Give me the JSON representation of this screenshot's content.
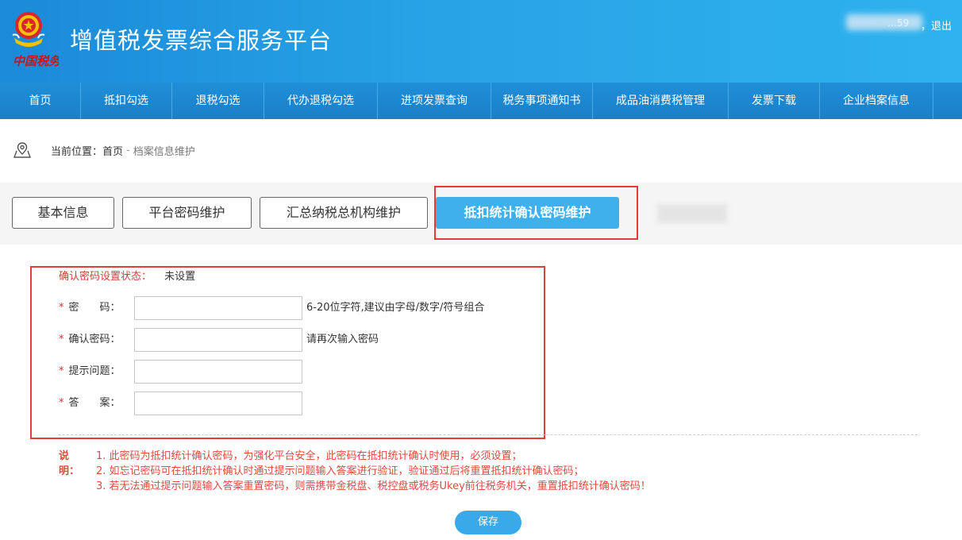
{
  "header": {
    "title": "增值税发票综合服务平台",
    "emblem_text": "中国税务",
    "user_partial": "…59",
    "logout_label": "，退出"
  },
  "nav": {
    "items": [
      {
        "label": "首页"
      },
      {
        "label": "抵扣勾选"
      },
      {
        "label": "退税勾选"
      },
      {
        "label": "代办退税勾选"
      },
      {
        "label": "进项发票查询"
      },
      {
        "label": "税务事项通知书"
      },
      {
        "label": "成品油消费税管理"
      },
      {
        "label": "发票下载"
      },
      {
        "label": "企业档案信息"
      }
    ]
  },
  "breadcrumb": {
    "label": "当前位置：",
    "home": "首页",
    "separator": "-",
    "current": "档案信息维护"
  },
  "tabs": [
    {
      "label": "基本信息"
    },
    {
      "label": "平台密码维护"
    },
    {
      "label": "汇总纳税总机构维护"
    },
    {
      "label": "抵扣统计确认密码维护",
      "active": true
    }
  ],
  "form": {
    "status_label": "确认密码设置状态：",
    "status_value": "未设置",
    "required_mark": "*",
    "password_label": "密　　码：",
    "password_hint": "6-20位字符,建议由字母/数字/符号组合",
    "confirm_label": "确认密码：",
    "confirm_hint": "请再次输入密码",
    "question_label": "提示问题：",
    "answer_label": "答　　案："
  },
  "notes": {
    "title": "说明：",
    "lines": [
      "1. 此密码为抵扣统计确认密码，为强化平台安全，此密码在抵扣统计确认时使用，必须设置；",
      "2. 如忘记密码可在抵扣统计确认时通过提示问题输入答案进行验证，验证通过后将重置抵扣统计确认密码；",
      "3. 若无法通过提示问题输入答案重置密码，则需携带金税盘、税控盘或税务Ukey前往税务机关，重置抵扣统计确认密码！"
    ]
  },
  "save_label": "保存",
  "colors": {
    "header_blue": "#27a3e6",
    "nav_blue": "#1f8fd8",
    "active_tab": "#3fb0ec",
    "highlight_red": "#e23c3c",
    "note_red": "#e04a3f"
  }
}
